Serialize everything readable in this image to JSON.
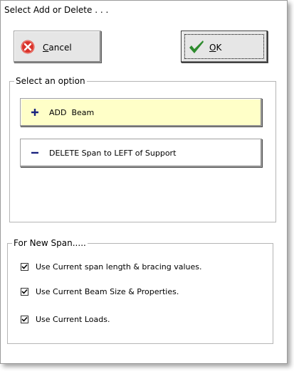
{
  "window": {
    "title": "Select Add or Delete . . ."
  },
  "buttons": {
    "cancel": {
      "label_first": "C",
      "label_rest": "ancel",
      "icon": "cancel-x-icon"
    },
    "ok": {
      "label_first": "O",
      "label_rest": "K",
      "icon": "checkmark-icon"
    }
  },
  "options_group": {
    "legend": "Select an option",
    "options": [
      {
        "label": "ADD  Beam",
        "icon": "plus-icon",
        "highlight_color": "#ffffc8"
      },
      {
        "label": "DELETE Span to LEFT of Support",
        "icon": "minus-icon"
      }
    ]
  },
  "new_span_group": {
    "legend": "For New Span.....",
    "checkboxes": [
      {
        "label": "Use Current span length & bracing values.",
        "checked": true
      },
      {
        "label": "Use Current Beam Size & Properties.",
        "checked": true
      },
      {
        "label": "Use Current Loads.",
        "checked": true
      }
    ]
  },
  "colors": {
    "cancel_red": "#d9332b",
    "ok_green": "#2e8b2e",
    "icon_blue": "#1a237e"
  }
}
